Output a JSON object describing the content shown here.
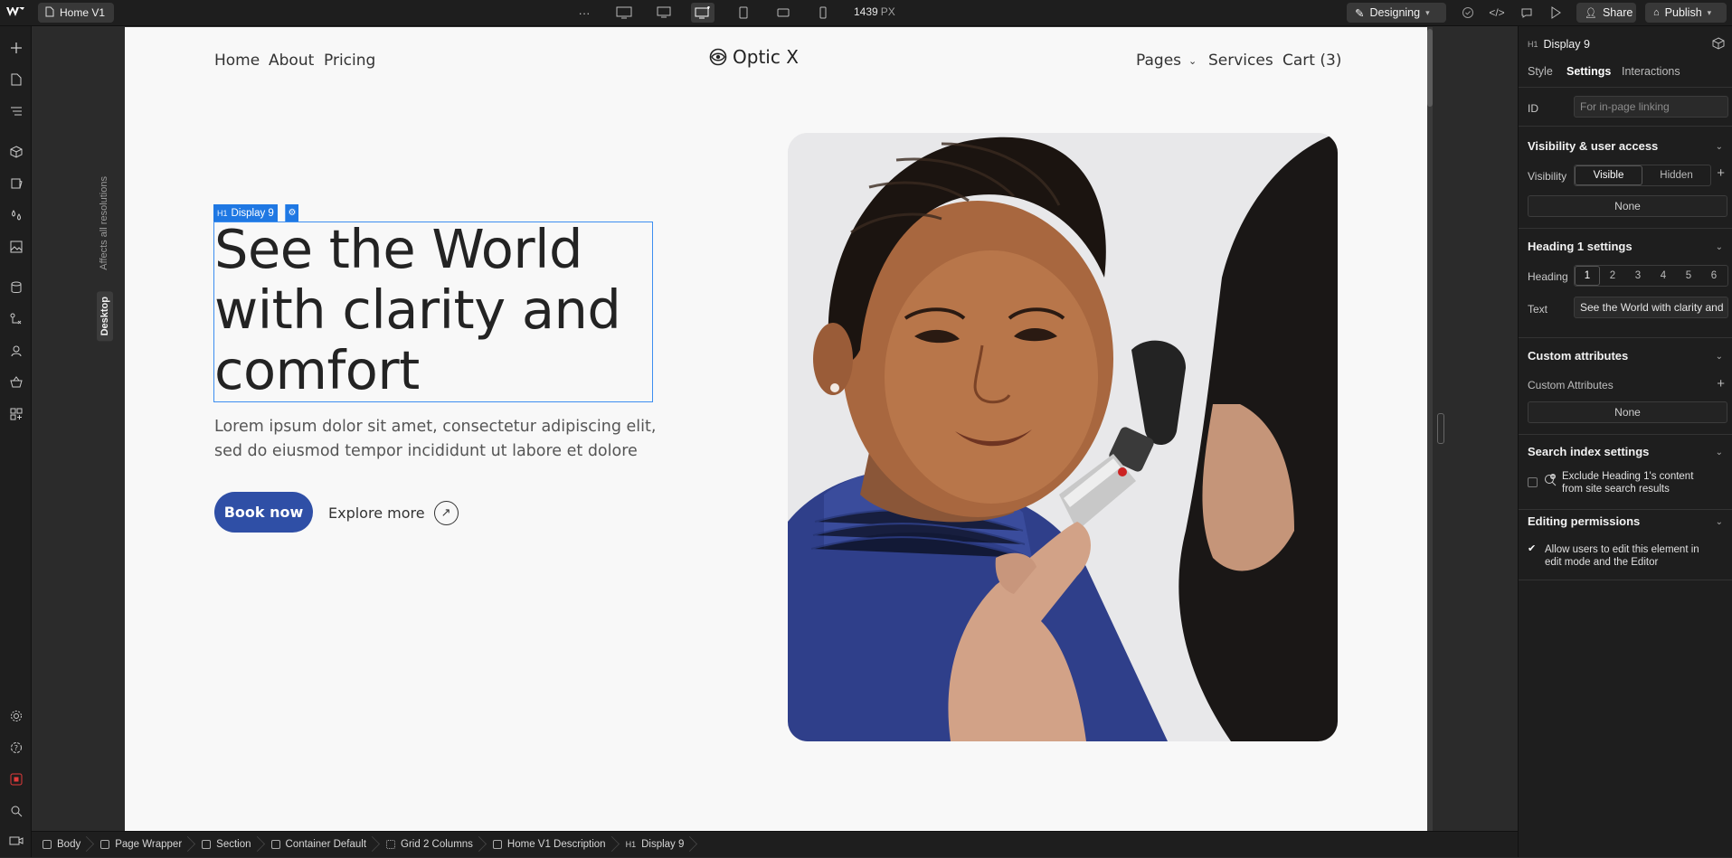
{
  "topbar": {
    "page_name": "Home V1",
    "more": "···",
    "width_value": "1439",
    "width_unit": "PX",
    "mode_label": "Designing",
    "share_label": "Share",
    "publish_label": "Publish"
  },
  "canvas": {
    "affects_label": "Affects all resolutions",
    "breakpoint_label": "Desktop"
  },
  "site": {
    "nav_left": [
      "Home",
      "About",
      "Pricing"
    ],
    "brand": "Optic X",
    "nav_right": [
      "Pages",
      "Services",
      "Cart (3)"
    ],
    "selected_tag": "Display 9",
    "selected_type": "H1",
    "hero_title": "See the World with clarity and comfort",
    "hero_body": "Lorem ipsum dolor sit amet, consectetur adipiscing elit, sed do eiusmod tempor incididunt ut labore et dolore",
    "primary_cta": "Book now",
    "secondary_cta": "Explore more",
    "hero_image_alt": "Optician examining a young woman's eye with an ophthalmoscope"
  },
  "panel": {
    "element_type": "H1",
    "element_name": "Display 9",
    "tabs": [
      "Style",
      "Settings",
      "Interactions"
    ],
    "active_tab": "Settings",
    "id_label": "ID",
    "id_placeholder": "For in-page linking",
    "visibility_heading": "Visibility & user access",
    "visibility_label": "Visibility",
    "visibility_options": [
      "Visible",
      "Hidden"
    ],
    "visibility_selected": "Visible",
    "visibility_none": "None",
    "heading_settings_heading": "Heading 1 settings",
    "heading_label": "Heading",
    "heading_levels": [
      "1",
      "2",
      "3",
      "4",
      "5",
      "6"
    ],
    "text_label": "Text",
    "text_value": "See the World with clarity and",
    "custom_attr_heading": "Custom attributes",
    "custom_attr_label": "Custom Attributes",
    "custom_attr_none": "None",
    "search_heading": "Search index settings",
    "search_exclude_line1": "Exclude Heading 1's content",
    "search_exclude_line2": "from site search results",
    "editing_heading": "Editing permissions",
    "editing_allow_line1": "Allow users to edit this element in",
    "editing_allow_line2": "edit mode and the Editor"
  },
  "breadcrumbs": [
    "Body",
    "Page Wrapper",
    "Section",
    "Container Default",
    "Grid 2 Columns",
    "Home V1 Description",
    "Display 9"
  ],
  "colors": {
    "accent_blue": "#1f78e3",
    "cta_blue": "#2f4fa6",
    "site_bg": "#f8f8f8",
    "editor_dark": "#1e1e1e"
  }
}
